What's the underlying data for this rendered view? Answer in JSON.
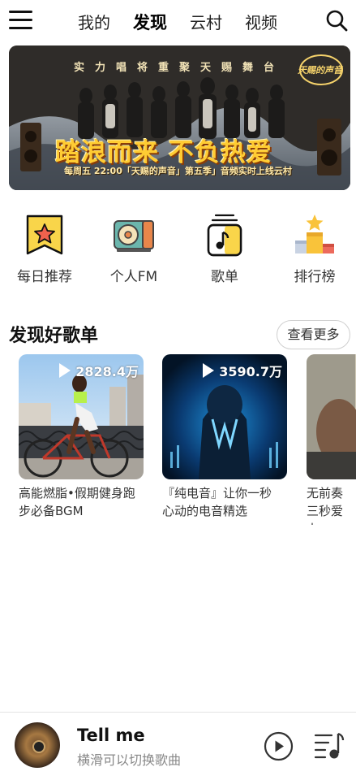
{
  "nav": {
    "tabs": [
      {
        "label": "我的",
        "active": false
      },
      {
        "label": "发现",
        "active": true
      },
      {
        "label": "云村",
        "active": false
      },
      {
        "label": "视频",
        "active": false
      }
    ],
    "menu_icon": "menu-icon",
    "search_icon": "search-icon"
  },
  "banner": {
    "top_text": "实力唱将重聚天赐舞台",
    "logo_text": "天赐的声音",
    "slogan": "踏浪而来 不负热爱",
    "subtitle": "每周五 22:00「天赐的声音」第五季」音频实时上线云村"
  },
  "entries": [
    {
      "label": "每日推荐",
      "icon": "daily-recommend-icon"
    },
    {
      "label": "个人FM",
      "icon": "radio-icon"
    },
    {
      "label": "歌单",
      "icon": "playlist-icon"
    },
    {
      "label": "排行榜",
      "icon": "ranking-icon"
    }
  ],
  "section": {
    "title": "发现好歌单",
    "more_label": "查看更多"
  },
  "playlists": [
    {
      "play_count": "2828.4万",
      "title": "高能燃脂•假期健身跑步必备BGM"
    },
    {
      "play_count": "3590.7万",
      "title": "『纯电音』让你一秒心动的电音精选"
    },
    {
      "play_count": "",
      "title": "无前奏三秒爱上"
    }
  ],
  "player": {
    "song_title": "Tell me",
    "hint": "横滑可以切换歌曲",
    "play_icon": "play-circle-icon",
    "list_icon": "playlist-queue-icon"
  },
  "colors": {
    "accent_gold": "#ffcc33",
    "text_primary": "#222222",
    "text_secondary": "#888888"
  }
}
